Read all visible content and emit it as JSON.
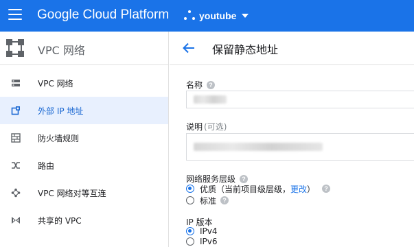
{
  "topbar": {
    "app_title": "Google Cloud Platform",
    "project_name": "youtube",
    "color": "#1a73e8"
  },
  "sidebar": {
    "title": "VPC 网络",
    "items": [
      {
        "label": "VPC 网络",
        "icon": "vpc-network-icon",
        "active": false
      },
      {
        "label": "外部 IP 地址",
        "icon": "external-ip-icon",
        "active": true
      },
      {
        "label": "防火墙规则",
        "icon": "firewall-icon",
        "active": false
      },
      {
        "label": "路由",
        "icon": "routes-icon",
        "active": false
      },
      {
        "label": "VPC 网络对等互连",
        "icon": "peering-icon",
        "active": false
      },
      {
        "label": "共享的 VPC",
        "icon": "shared-vpc-icon",
        "active": false
      }
    ]
  },
  "main": {
    "title": "保留静态地址",
    "name_field": {
      "label": "名称",
      "value": ""
    },
    "description_field": {
      "label": "说明",
      "optional_suffix": "(可选)",
      "value": ""
    },
    "tier": {
      "label": "网络服务层级",
      "options": [
        {
          "label": "优质（当前项目级层级，",
          "link": "更改",
          "suffix": "）",
          "checked": true
        },
        {
          "label": "标准",
          "checked": false
        }
      ]
    },
    "ip_version": {
      "label": "IP 版本",
      "options": [
        {
          "label": "IPv4",
          "checked": true
        },
        {
          "label": "IPv6",
          "checked": false
        }
      ]
    }
  }
}
